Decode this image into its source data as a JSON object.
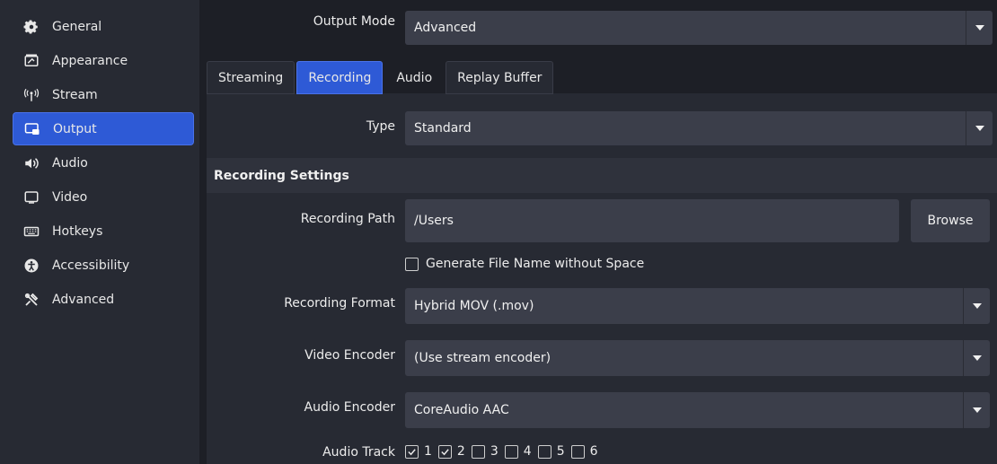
{
  "sidebar": {
    "items": [
      {
        "label": "General",
        "icon": "gear-icon"
      },
      {
        "label": "Appearance",
        "icon": "appearance-icon"
      },
      {
        "label": "Stream",
        "icon": "antenna-icon"
      },
      {
        "label": "Output",
        "icon": "output-icon",
        "active": true
      },
      {
        "label": "Audio",
        "icon": "speaker-icon"
      },
      {
        "label": "Video",
        "icon": "monitor-icon"
      },
      {
        "label": "Hotkeys",
        "icon": "keyboard-icon"
      },
      {
        "label": "Accessibility",
        "icon": "accessibility-icon"
      },
      {
        "label": "Advanced",
        "icon": "tools-icon"
      }
    ]
  },
  "output_mode": {
    "label": "Output Mode",
    "value": "Advanced"
  },
  "tabs": [
    {
      "label": "Streaming"
    },
    {
      "label": "Recording",
      "active": true
    },
    {
      "label": "Audio"
    },
    {
      "label": "Replay Buffer"
    }
  ],
  "type": {
    "label": "Type",
    "value": "Standard"
  },
  "recording_settings": {
    "header": "Recording Settings",
    "path_label": "Recording Path",
    "path_value": "/Users",
    "browse_label": "Browse",
    "no_space_label": "Generate File Name without Space",
    "no_space_checked": false,
    "format_label": "Recording Format",
    "format_value": "Hybrid MOV (.mov)",
    "video_encoder_label": "Video Encoder",
    "video_encoder_value": "(Use stream encoder)",
    "audio_encoder_label": "Audio Encoder",
    "audio_encoder_value": "CoreAudio AAC",
    "audio_track_label": "Audio Track",
    "audio_tracks": [
      {
        "num": "1",
        "checked": true
      },
      {
        "num": "2",
        "checked": true
      },
      {
        "num": "3",
        "checked": false
      },
      {
        "num": "4",
        "checked": false
      },
      {
        "num": "5",
        "checked": false
      },
      {
        "num": "6",
        "checked": false
      }
    ]
  },
  "colors": {
    "accent": "#2e5ad6",
    "sidebar_bg": "#272a33",
    "field_bg": "#3b3e4a"
  }
}
